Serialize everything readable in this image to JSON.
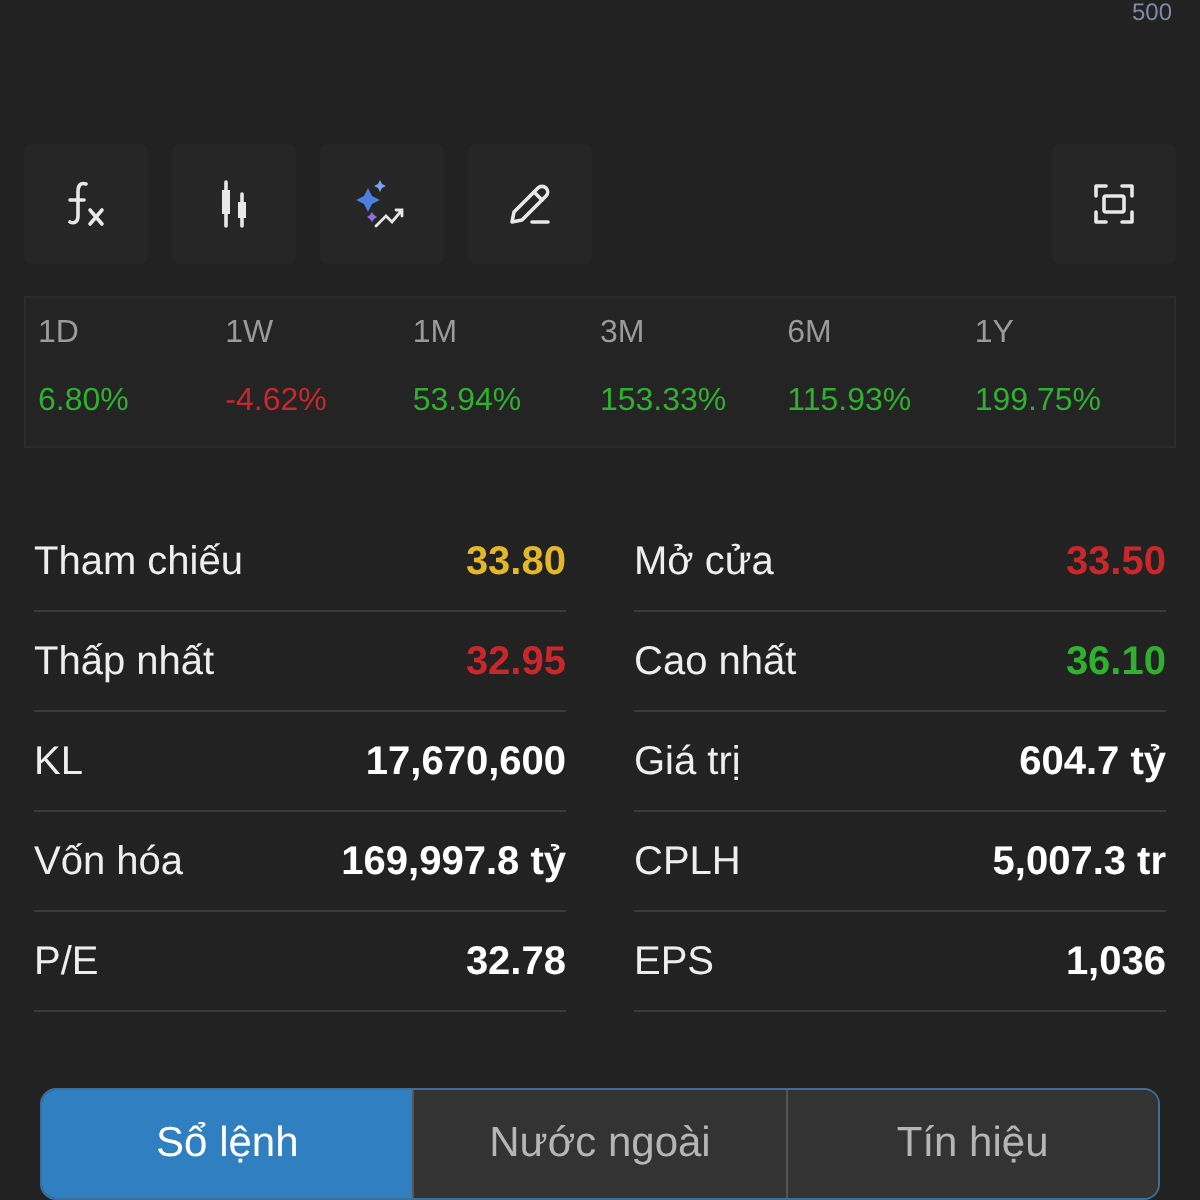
{
  "corner_label": "500",
  "toolbar": [
    {
      "kind": "formula"
    },
    {
      "kind": "candles"
    },
    {
      "kind": "sparkle"
    },
    {
      "kind": "pencil"
    },
    {
      "kind": "screen"
    }
  ],
  "periods": [
    {
      "label": "1D",
      "change": "6.80%",
      "color": "#2fb12f"
    },
    {
      "label": "1W",
      "change": "-4.62%",
      "color": "#c8282b"
    },
    {
      "label": "1M",
      "change": "53.94%",
      "color": "#2fb12f"
    },
    {
      "label": "3M",
      "change": "153.33%",
      "color": "#2fb12f"
    },
    {
      "label": "6M",
      "change": "115.93%",
      "color": "#2fb12f"
    },
    {
      "label": "1Y",
      "change": "199.75%",
      "color": "#2fb12f"
    }
  ],
  "stats": [
    {
      "label": "Tham chiếu",
      "value": "33.80",
      "color": "#e2b82a"
    },
    {
      "label": "Mở cửa",
      "value": "33.50",
      "color": "#c8282b"
    },
    {
      "label": "Thấp nhất",
      "value": "32.95",
      "color": "#c8282b"
    },
    {
      "label": "Cao nhất",
      "value": "36.10",
      "color": "#2fb12f"
    },
    {
      "label": "KL",
      "value": "17,670,600",
      "color": "#ffffff"
    },
    {
      "label": "Giá trị",
      "value": "604.7 tỷ",
      "color": "#ffffff"
    },
    {
      "label": "Vốn hóa",
      "value": "169,997.8 tỷ",
      "color": "#ffffff"
    },
    {
      "label": "CPLH",
      "value": "5,007.3 tr",
      "color": "#ffffff"
    },
    {
      "label": "P/E",
      "value": "32.78",
      "color": "#ffffff"
    },
    {
      "label": "EPS",
      "value": "1,036",
      "color": "#ffffff"
    }
  ],
  "tabs": [
    {
      "label": "Sổ lệnh",
      "selected": true
    },
    {
      "label": "Nước ngoài",
      "selected": false
    },
    {
      "label": "Tín hiệu",
      "selected": false
    }
  ]
}
